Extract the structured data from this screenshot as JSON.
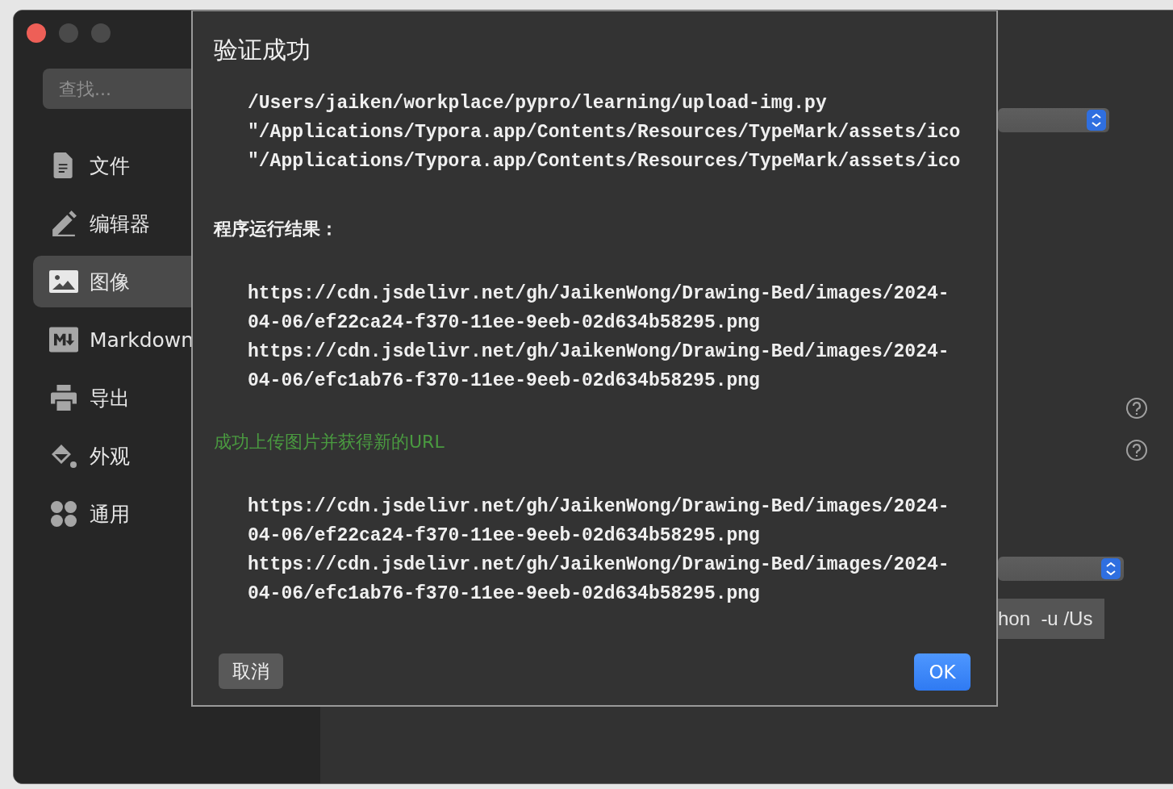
{
  "search": {
    "placeholder": "查找..."
  },
  "sidebar": {
    "items": [
      {
        "label": "文件",
        "kind": "file",
        "selected": false
      },
      {
        "label": "编辑器",
        "kind": "pen",
        "selected": false
      },
      {
        "label": "图像",
        "kind": "image",
        "selected": true
      },
      {
        "label": "Markdown",
        "kind": "markdown",
        "selected": false
      },
      {
        "label": "导出",
        "kind": "printer",
        "selected": false
      },
      {
        "label": "外观",
        "kind": "paint",
        "selected": false
      },
      {
        "label": "通用",
        "kind": "grid",
        "selected": false
      }
    ]
  },
  "settings": {
    "command_field": {
      "value": "hon  -u /Us"
    }
  },
  "dialog": {
    "title": "验证成功",
    "command_lines": [
      "/Users/jaiken/workplace/pypro/learning/upload-img.py",
      "\"/Applications/Typora.app/Contents/Resources/TypeMark/assets/ico",
      "\"/Applications/Typora.app/Contents/Resources/TypeMark/assets/ico"
    ],
    "result_heading": "程序运行结果：",
    "result_urls": [
      "https://cdn.jsdelivr.net/gh/JaikenWong/Drawing-Bed/images/2024-04-06/ef22ca24-f370-11ee-9eeb-02d634b58295.png",
      "https://cdn.jsdelivr.net/gh/JaikenWong/Drawing-Bed/images/2024-04-06/efc1ab76-f370-11ee-9eeb-02d634b58295.png"
    ],
    "success_message": "成功上传图片并获得新的URL",
    "new_urls": [
      "https://cdn.jsdelivr.net/gh/JaikenWong/Drawing-Bed/images/2024-04-06/ef22ca24-f370-11ee-9eeb-02d634b58295.png",
      "https://cdn.jsdelivr.net/gh/JaikenWong/Drawing-Bed/images/2024-04-06/efc1ab76-f370-11ee-9eeb-02d634b58295.png"
    ],
    "buttons": [
      {
        "label": "取消",
        "kind": "secondary"
      },
      {
        "label": "OK",
        "kind": "primary"
      }
    ]
  }
}
